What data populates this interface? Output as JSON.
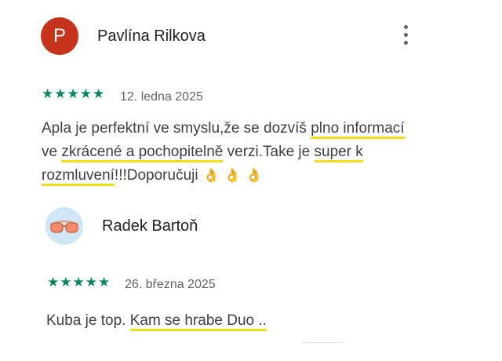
{
  "reviews": [
    {
      "author": "Pavlína Rilkova",
      "avatar_letter": "P",
      "avatar_color": "#c5341a",
      "rating": 5,
      "stars": "★★★★★",
      "date": "12. ledna 2025",
      "text_parts": [
        "Apla je perfektní ve smyslu,že se dozvíš ",
        "plno informací",
        " ve ",
        "zkrácené a pochopitelně",
        " verzi.Take je ",
        "super k rozmluvení",
        "!!!Doporučuji"
      ],
      "emoji": [
        "👌",
        "👌",
        "👌"
      ],
      "has_more_menu": true,
      "more_icon": "more-vert-icon"
    },
    {
      "author": "Radek Bartoň",
      "avatar_icon": "sunglasses-icon",
      "rating": 5,
      "stars": "★★★★★",
      "date": "26. března 2025",
      "text_parts": [
        "Kuba je top. ",
        "Kam se hrabe Duo .."
      ]
    }
  ],
  "colors": {
    "star": "#01875f",
    "highlight": "#f1df1c"
  }
}
